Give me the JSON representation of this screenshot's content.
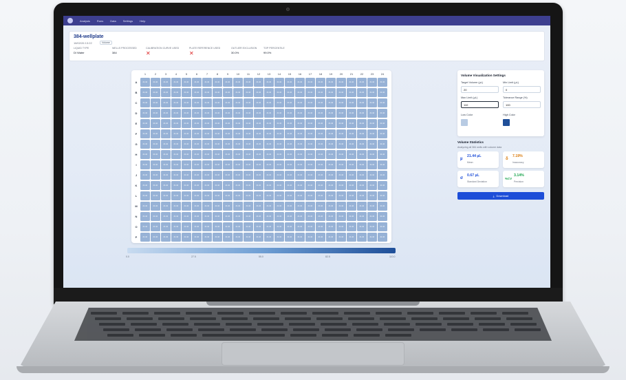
{
  "app": {
    "nav": [
      "Analysis",
      "Runs",
      "Data",
      "Settings",
      "Help"
    ]
  },
  "header": {
    "title": "384-wellplate",
    "date": "18/02/26 13:22",
    "badge": "Volume",
    "meta": [
      {
        "label": "LIQUID TYPE",
        "value": "DI Water"
      },
      {
        "label": "WELLS PROCESSED",
        "value": "384"
      },
      {
        "label": "CALIBRATION CURVE USED",
        "value": ""
      },
      {
        "label": "PLATE REFERENCE USED",
        "value": ""
      },
      {
        "label": "OUTLIER EXCLUSION",
        "value": "30.0%"
      },
      {
        "label": "TOP PERCENTILE",
        "value": "99.0%"
      }
    ],
    "flags": {
      "calibration": "✕",
      "plate_reference": "✕"
    }
  },
  "plate": {
    "columns": [
      "1",
      "2",
      "3",
      "4",
      "5",
      "6",
      "7",
      "8",
      "9",
      "10",
      "11",
      "12",
      "13",
      "14",
      "15",
      "16",
      "17",
      "18",
      "19",
      "20",
      "21",
      "22",
      "23",
      "24"
    ],
    "rows": [
      "A",
      "B",
      "C",
      "D",
      "E",
      "F",
      "G",
      "H",
      "I",
      "J",
      "K",
      "L",
      "M",
      "N",
      "O",
      "P"
    ],
    "well_value": "21.44"
  },
  "scale": {
    "ticks": [
      "0.0",
      "27.5",
      "55.0",
      "82.5",
      "110.0"
    ]
  },
  "settings": {
    "title": "Volume Visualization Settings",
    "target_label": "Target Volume (µL)",
    "target_value": "20",
    "min_label": "Min Limit (µL)",
    "min_value": "0",
    "max_label": "Max Limit (µL)",
    "max_value": "110",
    "tol_label": "Tolerance Range (%)",
    "tol_value": "100",
    "low_label": "Low Color",
    "high_label": "High Color",
    "low_color": "#b8cbe3",
    "high_color": "#1f4f99"
  },
  "stats": {
    "title": "Volume Statistics",
    "desc": "Analyzing all 384 wells with volume data",
    "mean": {
      "icon": "µ",
      "value": "21.44 µL",
      "label": "Mean"
    },
    "accuracy": {
      "icon": "δ",
      "value": "7.19%",
      "label": "Inaccuracy"
    },
    "std": {
      "icon": "σ",
      "value": "0.67 µL",
      "label": "Standard Deviation"
    },
    "cv": {
      "icon": "%CV",
      "value": "3.14%",
      "label": "Precision"
    }
  },
  "download": {
    "label": "Download",
    "icon": "⤓"
  }
}
